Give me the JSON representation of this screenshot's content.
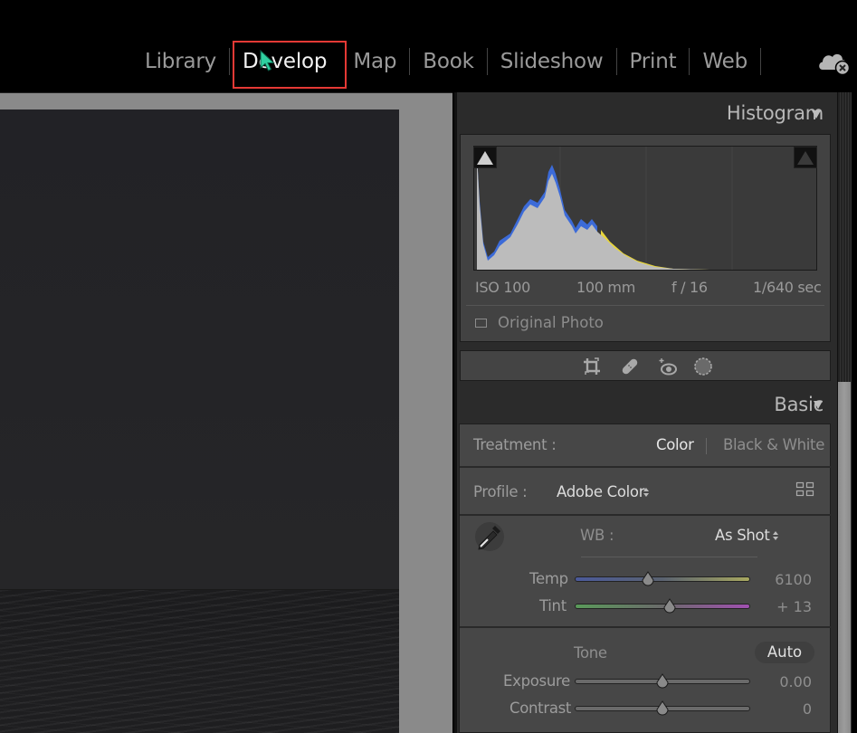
{
  "topbar": {
    "modules": [
      {
        "label": "Library",
        "active": false
      },
      {
        "label": "Develop",
        "active": true
      },
      {
        "label": "Map",
        "active": false
      },
      {
        "label": "Book",
        "active": false
      },
      {
        "label": "Slideshow",
        "active": false
      },
      {
        "label": "Print",
        "active": false
      },
      {
        "label": "Web",
        "active": false
      }
    ],
    "highlight_color": "#e53935",
    "cursor_color": "#2fd0a0",
    "sync_icon": "cloud-sync-error-icon"
  },
  "histogram": {
    "title": "Histogram",
    "exif": {
      "iso": "ISO 100",
      "focal_length": "100 mm",
      "aperture": "f / 16",
      "shutter": "1/640 sec"
    },
    "original_photo_label": "Original Photo",
    "original_photo_checked": false
  },
  "tools": [
    {
      "name": "crop-overlay-icon"
    },
    {
      "name": "spot-removal-icon"
    },
    {
      "name": "red-eye-correction-icon"
    },
    {
      "name": "masking-icon"
    }
  ],
  "basic": {
    "title": "Basic",
    "treatment": {
      "label": "Treatment :",
      "options": [
        "Color",
        "Black & White"
      ],
      "selected": "Color"
    },
    "profile": {
      "label": "Profile :",
      "value": "Adobe Color"
    },
    "wb": {
      "label": "WB :",
      "value": "As Shot"
    },
    "temp": {
      "label": "Temp",
      "value": "6100",
      "position": 0.42
    },
    "tint": {
      "label": "Tint",
      "value": "+ 13",
      "position": 0.54
    },
    "tone": {
      "label": "Tone",
      "auto_label": "Auto"
    },
    "exposure": {
      "label": "Exposure",
      "value": "0.00",
      "position": 0.5
    },
    "contrast": {
      "label": "Contrast",
      "value": "0",
      "position": 0.5
    }
  }
}
